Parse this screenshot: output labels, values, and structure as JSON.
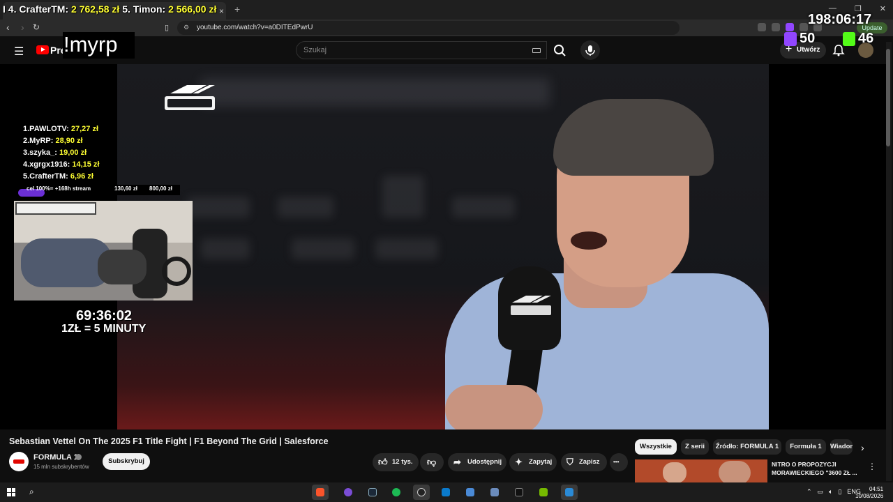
{
  "browser": {
    "tab_close": "×",
    "new_tab": "+",
    "window_controls": [
      "—",
      "❐",
      "✕"
    ],
    "url": "youtube.com/watch?v=a0DITEdPwrU",
    "update_label": "Update"
  },
  "youtube": {
    "brand": "Pre",
    "search_placeholder": "Szukaj",
    "create_label": "Utwórz"
  },
  "overlay": {
    "command": "!myrp",
    "stream_timer": "198:06:17",
    "top_donors": [
      {
        "name": "4. CrafterTM:",
        "value": "2 762,58 zł"
      },
      {
        "name": "5. Timon:",
        "value": "2 566,00 zł"
      }
    ],
    "top_donors_prefix": "I",
    "leaderboard": [
      {
        "name": "1.PAWLOTV:",
        "value": "27,27 zł"
      },
      {
        "name": "2.MyRP:",
        "value": "28,90 zł"
      },
      {
        "name": "3.szyka_:",
        "value": "19,00 zł"
      },
      {
        "name": "4.xgrgx1916:",
        "value": "14,15 zł"
      },
      {
        "name": "5.CrafterTM:",
        "value": "6,96 zł"
      }
    ],
    "goal": {
      "label": "cel 100%= +168h stream",
      "current": "130,60 zł",
      "target": "800,00 zł",
      "progress": 0.1633
    },
    "subathon_timer": "69:36:02",
    "subathon_rate": "1ZŁ = 5 MINUTY",
    "twitch_count": "50",
    "kick_count": "46",
    "colors": {
      "twitch": "#9146ff",
      "kick": "#53fc18",
      "goal_fill": "#6b2fd6",
      "donor_value": "#ffff33"
    }
  },
  "video": {
    "title": "Sebastian Vettel On The 2025 F1 Title Fight | F1 Beyond The Grid | Salesforce",
    "channel": "FORMULA 1",
    "subscribers": "15 mln subskrybentów",
    "subscribe_label": "Subskrybuj",
    "likes": "12 tys.",
    "share_label": "Udostępnij",
    "ask_label": "Zapytaj",
    "save_label": "Zapisz",
    "more_label": "•••"
  },
  "chips": [
    "Wszystkie",
    "Z serii",
    "Źródło: FORMULA 1",
    "Formuła 1",
    "Wiadom"
  ],
  "recommendation": {
    "title_line1": "NITRO O PROPOZYCJI",
    "title_line2": "MORAWIECKIEGO \"3600 ZŁ ..."
  },
  "taskbar": {
    "lang": "ENG",
    "time": "04:51",
    "date": "10/08/2026"
  }
}
